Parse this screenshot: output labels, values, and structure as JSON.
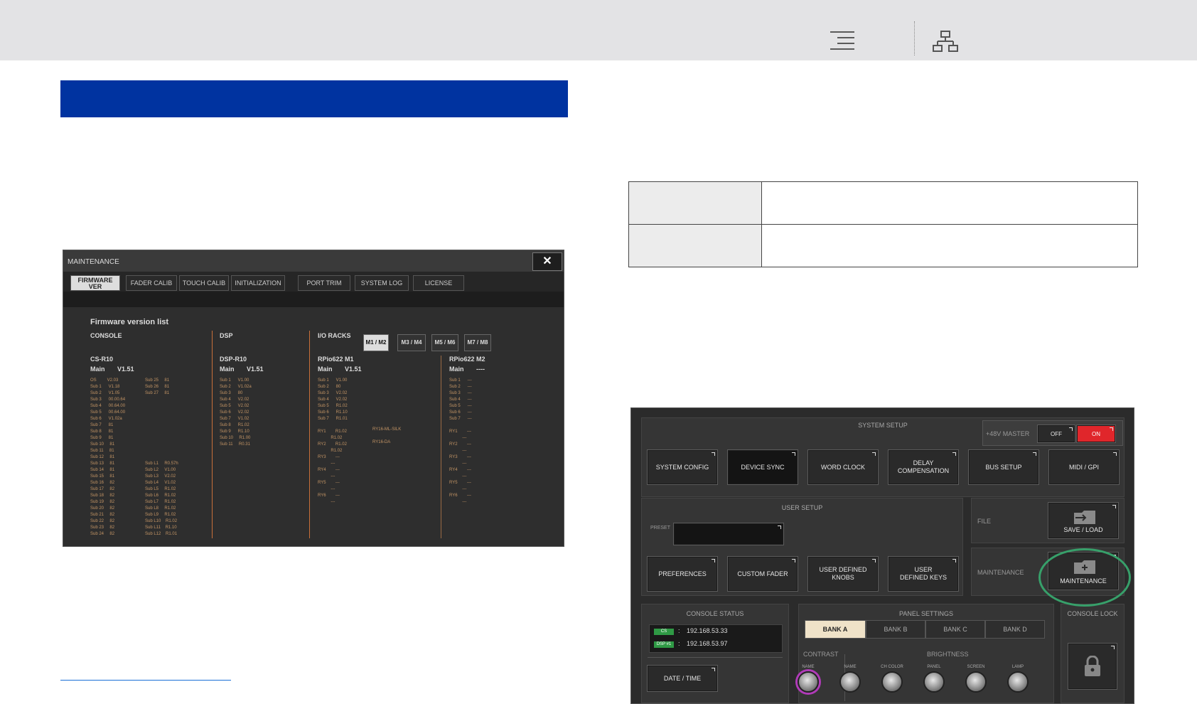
{
  "maintenance_window": {
    "title": "MAINTENANCE",
    "close_glyph": "✕",
    "tabs": [
      {
        "label": "FIRMWARE VER",
        "active": true
      },
      {
        "label": "FADER CALIB",
        "active": false
      },
      {
        "label": "TOUCH CALIB",
        "active": false
      },
      {
        "label": "INITIALIZATION",
        "active": false
      },
      {
        "label": "PORT TRIM",
        "active": false
      },
      {
        "label": "SYSTEM LOG",
        "active": false
      },
      {
        "label": "LICENSE",
        "active": false
      }
    ],
    "list_title": "Firmware version list",
    "console": {
      "heading": "CONSOLE",
      "model": "CS-R10",
      "main_label": "Main",
      "main_version": "V1.51",
      "col1": "OS         V2.03\nSub 1      V1.18\nSub 2      V1.05\nSub 3      00.00.64\nSub 4      00.64.00\nSub 5      00.64.00\nSub 6      V1.02a\nSub 7      81\nSub 8      81\nSub 9      81\nSub 10     81\nSub 11     81\nSub 12     81\nSub 13     81\nSub 14     81\nSub 15     81\nSub 16     82\nSub 17     82\nSub 18     82\nSub 19     82\nSub 20     82\nSub 21     82\nSub 22     82\nSub 23     82\nSub 24     82",
      "col2": "Sub 25     81\nSub 26     81\nSub 27     81\n\n\n\n\n\n\n\n\n\n\nSub L1     R0.57h\nSub L2     V1.00\nSub L3     V2.02\nSub L4     V1.02\nSub L5     R1.02\nSub L6     R1.02\nSub L7     R1.02\nSub L8     R1.02\nSub L9     R1.02\nSub L10    R1.02\nSub L11    R1.10\nSub L12    R1.01"
    },
    "dsp": {
      "heading": "DSP",
      "model": "DSP-R10",
      "main_label": "Main",
      "main_version": "V1.51",
      "list": "Sub 1      V1.00\nSub 2      V1.02a\nSub 3      80\nSub 4      V2.02\nSub 5      V2.02\nSub 6      V2.02\nSub 7      V1.02\nSub 8      R1.02\nSub 9      R1.10\nSub 10     R1.00\nSub 11     R0.31"
    },
    "io_racks": {
      "heading": "I/O RACKS",
      "buttons": [
        "M1 / M2",
        "M3 / M4",
        "M5 / M6",
        "M7 / M8"
      ],
      "rack1": {
        "model": "RPio622 M1",
        "main_label": "Main",
        "main_version": "V1.51",
        "list": "Sub 1      V1.00\nSub 2      80\nSub 3      V2.02\nSub 4      V2.02\nSub 5      R1.02\nSub 6      R1.10\nSub 7      R1.01\n\nRY1        R1.02\n           R1.02\nRY2        R1.02\n           R1.02\nRY3        ---\n           ---\nRY4        ---\n           ---\nRY5        ---\n           ---\nRY6        ---\n           ---",
        "cards": "RY16-ML-SILK\n\nRY16-DA"
      },
      "rack2": {
        "model": "RPio622 M2",
        "main_label": "Main",
        "main_version": "----",
        "list": "Sub 1      ---\nSub 2      ---\nSub 3      ---\nSub 4      ---\nSub 5      ---\nSub 6      ---\nSub 7      ---\n\nRY1        ---\n           ---\nRY2        ---\n           ---\nRY3        ---\n           ---\nRY4        ---\n           ---\nRY5        ---\n           ---\nRY6        ---\n           ---"
      }
    }
  },
  "system_setup": {
    "title": "SYSTEM SETUP",
    "phantom_label": "+48V MASTER",
    "off_label": "OFF",
    "on_label": "ON",
    "buttons": [
      "SYSTEM CONFIG",
      "DEVICE SYNC",
      "WORD CLOCK",
      "DELAY COMPENSATION",
      "BUS SETUP",
      "MIDI / GPI"
    ],
    "user_setup": {
      "title": "USER SETUP",
      "preset_label": "PRESET",
      "buttons": [
        "PREFERENCES",
        "CUSTOM FADER",
        "USER DEFINED KNOBS",
        "USER DEFINED KEYS"
      ]
    },
    "file": {
      "label": "FILE",
      "button": "SAVE / LOAD"
    },
    "maintenance": {
      "label": "MAINTENANCE",
      "button": "MAINTENANCE"
    },
    "console_status": {
      "title": "CONSOLE STATUS",
      "rows": [
        {
          "tag": "CS",
          "sep": ":",
          "ip": "192.168.53.33"
        },
        {
          "tag": "DSP #1",
          "sep": ":",
          "ip": "192.168.53.97"
        }
      ],
      "date_time": "DATE / TIME"
    },
    "panel_settings": {
      "title": "PANEL SETTINGS",
      "banks": [
        "BANK A",
        "BANK B",
        "BANK C",
        "BANK D"
      ],
      "contrast_label": "CONTRAST",
      "brightness_label": "BRIGHTNESS",
      "knobs": [
        "NAME",
        "NAME",
        "CH COLOR",
        "PANEL",
        "SCREEN",
        "LAMP"
      ]
    },
    "console_lock": {
      "title": "CONSOLE LOCK"
    }
  }
}
